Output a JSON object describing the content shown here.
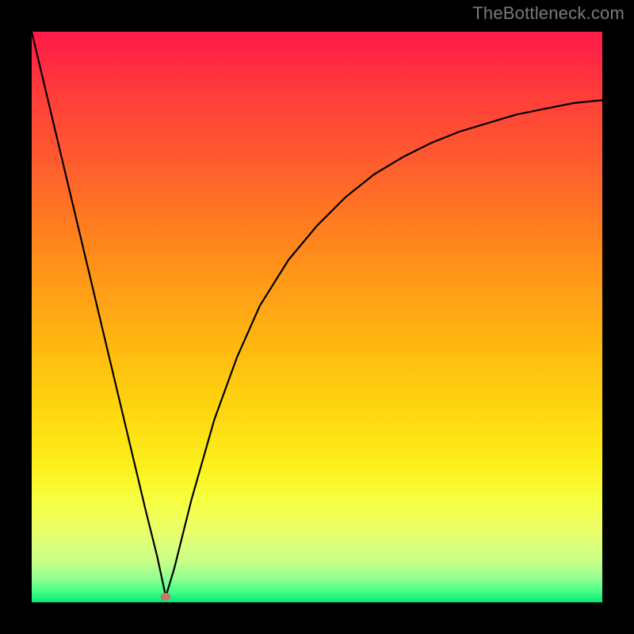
{
  "watermark": "TheBottleneck.com",
  "colors": {
    "background": "#000000",
    "marker": "#c27a6a",
    "curve": "#000000",
    "gradient_stops": [
      "#ff1a4a",
      "#ff3a3a",
      "#ff5a2f",
      "#ff7a20",
      "#ff9a18",
      "#ffb810",
      "#fed50f",
      "#fcf01a",
      "#f6ff40",
      "#ecff66",
      "#dcff7a",
      "#c6ff88",
      "#8bff92",
      "#4aff88",
      "#00e878"
    ]
  },
  "chart_data": {
    "type": "line",
    "title": "",
    "xlabel": "",
    "ylabel": "",
    "xlim": [
      0,
      100
    ],
    "ylim": [
      0,
      100
    ],
    "grid": false,
    "legend": "none",
    "notes": "V-shaped bottleneck curve on red→green vertical gradient. x ~ hardware-balance parameter (0–100), y ~ bottleneck percentage (0–100). Single marker at the minimum.",
    "series": [
      {
        "name": "bottleneck-curve",
        "x": [
          0,
          5,
          10,
          15,
          20,
          22,
          23.5,
          25,
          28,
          32,
          36,
          40,
          45,
          50,
          55,
          60,
          65,
          70,
          75,
          80,
          85,
          90,
          95,
          100
        ],
        "y": [
          100,
          79,
          58,
          37,
          16,
          8,
          1,
          6,
          18,
          32,
          43,
          52,
          60,
          66,
          71,
          75,
          78,
          80.5,
          82.5,
          84,
          85.5,
          86.5,
          87.5,
          88
        ]
      }
    ],
    "marker": {
      "x": 23.5,
      "y": 1
    }
  }
}
